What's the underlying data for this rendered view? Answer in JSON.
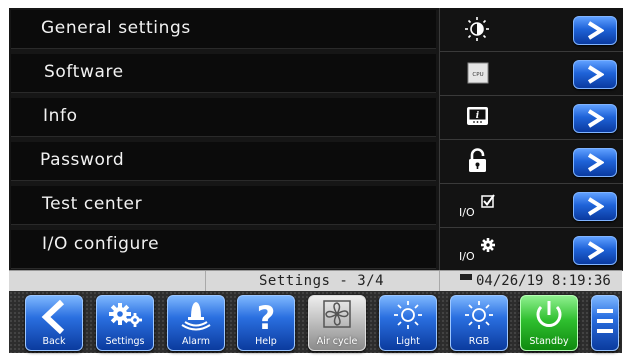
{
  "menu": [
    {
      "label": "General settings",
      "icon": "brightness-contrast-icon"
    },
    {
      "label": "Software",
      "icon": "cpu-icon"
    },
    {
      "label": "Info",
      "icon": "info-display-icon"
    },
    {
      "label": "Password",
      "icon": "unlock-icon"
    },
    {
      "label": "Test center",
      "icon": "io-check-icon"
    },
    {
      "label": "I/O configure",
      "icon": "io-gear-icon"
    }
  ],
  "icon_text": {
    "cpu": "CPU",
    "io": "I/O"
  },
  "status": {
    "page": "Settings - 3/4",
    "datetime": "04/26/19 8:19:36"
  },
  "toolbar": [
    {
      "label": "Back",
      "icon": "back-arrow-icon",
      "style": "blue"
    },
    {
      "label": "Settings",
      "icon": "gears-icon",
      "style": "blue"
    },
    {
      "label": "Alarm",
      "icon": "alarm-icon",
      "style": "blue"
    },
    {
      "label": "Help",
      "icon": "help-icon",
      "style": "blue"
    },
    {
      "label": "Air cycle",
      "icon": "fan-icon",
      "style": "gray"
    },
    {
      "label": "Light",
      "icon": "light-icon",
      "style": "blue"
    },
    {
      "label": "RGB",
      "icon": "rgb-light-icon",
      "style": "blue"
    },
    {
      "label": "Standby",
      "icon": "power-icon",
      "style": "green"
    },
    {
      "label": "",
      "icon": "menu-icon",
      "style": "blue"
    }
  ],
  "colors": {
    "accent_blue": "#1f63d8",
    "standby_green": "#2fbf2f",
    "panel": "#161616",
    "status_bar": "#d9d9d9"
  }
}
